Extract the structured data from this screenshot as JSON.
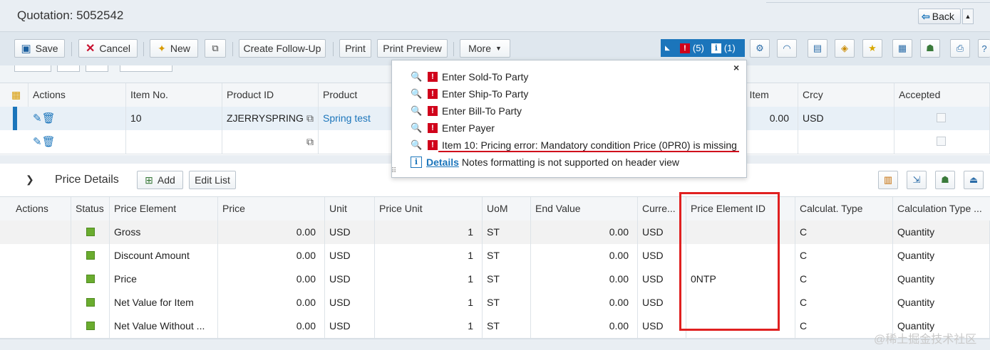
{
  "header": {
    "title": "Quotation: 5052542",
    "back_label": "Back",
    "back_dropdown": "▲"
  },
  "toolbar": {
    "save_label": "Save",
    "cancel_label": "Cancel",
    "new_label": "New",
    "create_followup_label": "Create Follow-Up",
    "print_label": "Print",
    "print_preview_label": "Print Preview",
    "more_label": "More",
    "message_indicator": {
      "error_count": "(5)",
      "info_count": "(1)"
    },
    "icon_buttons": [
      "gear-icon",
      "rss-icon",
      "settings-page-icon",
      "tag-icon",
      "star-add-icon",
      "document-icon",
      "user-edit-icon",
      "printer-icon",
      "help-icon"
    ]
  },
  "items": {
    "columns": [
      "Actions",
      "Item No.",
      "Product ID",
      "Product",
      "r Item",
      "Crcy",
      "Accepted"
    ],
    "rows": [
      {
        "item_no": "10",
        "product_id": "ZJERRYSPRING",
        "product": "Spring test",
        "net_value": "0.00",
        "currency": "USD"
      },
      {
        "item_no": "",
        "product_id": "",
        "product": "",
        "net_value": "",
        "currency": ""
      }
    ]
  },
  "popover": {
    "messages": [
      "Enter Sold-To Party",
      "Enter Ship-To Party",
      "Enter Bill-To Party",
      "Enter Payer",
      "Item 10: Pricing error: Mandatory condition Price (0PR0) is missing"
    ],
    "details_link": "Details",
    "details_text": "Notes formatting is not supported on header view",
    "close_label": "×"
  },
  "price_details": {
    "title": "Price Details",
    "add_label": "Add",
    "edit_list_label": "Edit List",
    "columns": [
      "Actions",
      "Status",
      "Price Element",
      "Price",
      "Unit",
      "Price Unit",
      "UoM",
      "End Value",
      "Curre...",
      "Price Element ID",
      "Calculat. Type",
      "Calculation Type ..."
    ],
    "rows": [
      {
        "element": "Gross",
        "price": "0.00",
        "unit": "USD",
        "price_unit": "1",
        "uom": "ST",
        "end_value": "0.00",
        "currency": "USD",
        "element_id": "",
        "calc_type": "C",
        "calc_type_desc": "Quantity"
      },
      {
        "element": "Discount Amount",
        "price": "0.00",
        "unit": "USD",
        "price_unit": "1",
        "uom": "ST",
        "end_value": "0.00",
        "currency": "USD",
        "element_id": "",
        "calc_type": "C",
        "calc_type_desc": "Quantity"
      },
      {
        "element": "Price",
        "price": "0.00",
        "unit": "USD",
        "price_unit": "1",
        "uom": "ST",
        "end_value": "0.00",
        "currency": "USD",
        "element_id": "0NTP",
        "calc_type": "C",
        "calc_type_desc": "Quantity"
      },
      {
        "element": "Net Value for Item",
        "price": "0.00",
        "unit": "USD",
        "price_unit": "1",
        "uom": "ST",
        "end_value": "0.00",
        "currency": "USD",
        "element_id": "",
        "calc_type": "C",
        "calc_type_desc": "Quantity"
      },
      {
        "element": "Net Value Without ...",
        "price": "0.00",
        "unit": "USD",
        "price_unit": "1",
        "uom": "ST",
        "end_value": "0.00",
        "currency": "USD",
        "element_id": "",
        "calc_type": "C",
        "calc_type_desc": "Quantity"
      }
    ]
  },
  "watermark": "@稀土掘金技术社区",
  "colors": {
    "accent": "#1b75bb",
    "error": "#d0021b",
    "status_ok": "#6aac2e",
    "annotation": "#e02020"
  }
}
